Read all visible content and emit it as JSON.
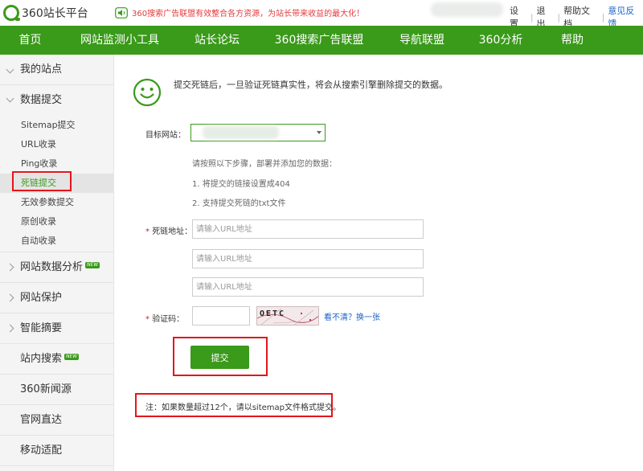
{
  "header": {
    "logo_text": "360站长平台",
    "notice": "360搜索广告联盟有效整合各方资源，为站长带来收益的最大化！",
    "links": [
      "设置",
      "退出",
      "帮助文档",
      "意见反馈"
    ]
  },
  "nav": {
    "items": [
      "首页",
      "网站监测小工具",
      "站长论坛",
      "360搜索广告联盟",
      "导航联盟",
      "360分析",
      "帮助"
    ]
  },
  "sidebar": {
    "my_sites": "我的站点",
    "data_submit": "数据提交",
    "sub_items": [
      "Sitemap提交",
      "URL收录",
      "Ping收录",
      "死链提交",
      "无效参数提交",
      "原创收录",
      "自动收录"
    ],
    "active_sub": "死链提交",
    "site_analysis": "网站数据分析",
    "new_badge": "NEW",
    "site_protect": "网站保护",
    "smart_summary": "智能摘要",
    "site_search": "站内搜索",
    "news_source": "360新闻源",
    "official_direct": "官网直达",
    "mobile_adapt": "移动适配"
  },
  "form": {
    "intro": "提交死链后，一旦验证死链真实性，将会从搜索引擎删除提交的数据。",
    "target_site_label": "目标网站：",
    "steps_title": "请按照以下步骤，部署并添加您的数据：",
    "step1": "1. 将提交的链接设置成404",
    "step2": "2. 支持提交死链的txt文件",
    "required_mark": "*",
    "deadlink_label": "死链地址：",
    "url_placeholder": "请输入URL地址",
    "captcha_label": "验证码：",
    "captcha_text": "OETC",
    "refresh_link": "看不清？换一张",
    "submit_label": "提交",
    "footnote": "注：如果数量超过12个，请以sitemap文件格式提交。"
  },
  "colors": {
    "brand_green": "#3a9a1a",
    "alert_red": "#e3161c",
    "link_blue": "#1a62c8"
  }
}
